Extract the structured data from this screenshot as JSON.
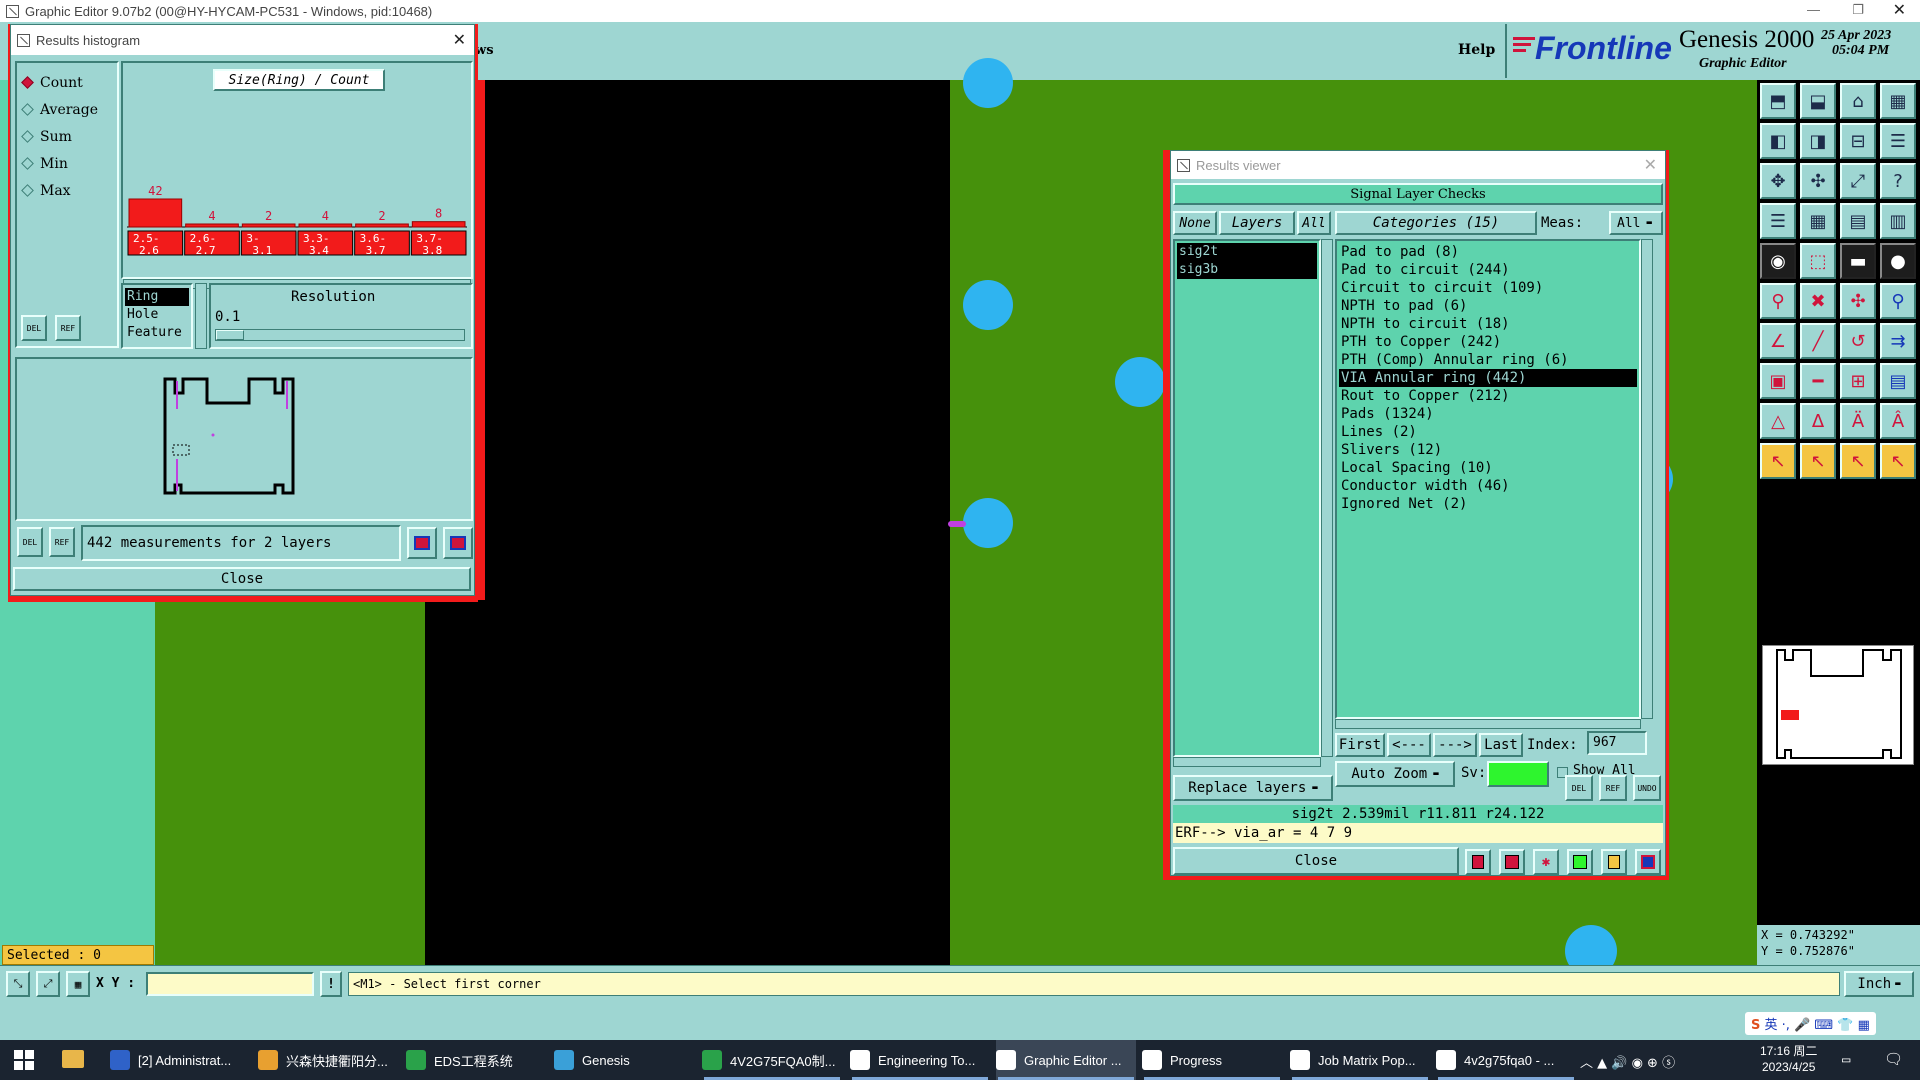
{
  "app": {
    "title": "Graphic Editor 9.07b2 (00@HY-HYCAM-PC531 - Windows, pid:10468)",
    "menu_partial": "ws",
    "help": "Help",
    "brand": "Frontline",
    "product": "Genesis 2000",
    "product_sub": "Graphic Editor",
    "date": "25 Apr 2023",
    "time": "05:04 PM"
  },
  "histogram": {
    "window_title": "Results histogram",
    "modes": [
      "Count",
      "Average",
      "Sum",
      "Min",
      "Max"
    ],
    "selected_mode": "Count",
    "header": "Size(Ring) / Count",
    "scope_items": [
      "Ring",
      "Hole",
      "Feature"
    ],
    "selected_scope": "Ring",
    "resolution_label": "Resolution",
    "resolution_value": "0.1",
    "status": "442 measurements for 2 layers",
    "close": "Close",
    "del": "DEL",
    "ref": "REF",
    "chart_data": {
      "type": "bar",
      "categories": [
        "2.5-2.6",
        "2.6-2.7",
        "3-3.1",
        "3.3-3.4",
        "3.6-3.7",
        "3.7-3.8"
      ],
      "values": [
        42,
        4,
        2,
        4,
        2,
        8
      ],
      "title": "Size(Ring) / Count",
      "xlabel": "",
      "ylabel": ""
    }
  },
  "viewer": {
    "window_title": "Results viewer",
    "header": "Signal Layer Checks",
    "none": "None",
    "layers": "Layers",
    "all": "All",
    "categories_label": "Categories (15)",
    "meas_label": "Meas:",
    "meas_value": "All",
    "layer_list": [
      "sig2t",
      "sig3b"
    ],
    "categories": [
      "Pad to pad (8)",
      "Pad to circuit (244)",
      "Circuit to circuit (109)",
      "NPTH to pad (6)",
      "NPTH to circuit (18)",
      "PTH to Copper (242)",
      "PTH (Comp) Annular ring (6)",
      "VIA Annular ring (442)",
      "Rout to Copper (212)",
      "Pads (1324)",
      "Lines (2)",
      "Slivers (12)",
      "Local Spacing (10)",
      "Conductor width (46)",
      "Ignored Net (2)"
    ],
    "selected_category": "VIA Annular ring (442)",
    "first": "First",
    "prev": "<---",
    "next": "--->",
    "last": "Last",
    "index_label": "Index:",
    "index_value": "967",
    "auto_zoom": "Auto Zoom",
    "sv": "Sv:",
    "show_all": "Show All",
    "replace_layers": "Replace layers",
    "del": "DEL",
    "ref": "REF",
    "undo": "UNDO",
    "info": "sig2t 2.539mil  r11.811  r24.122",
    "erf": "ERF--> via_ar = 4 7 9",
    "close": "Close"
  },
  "status": {
    "selected": "Selected : 0",
    "xy_label": "X Y :",
    "prompt": "<M1> - Select first corner",
    "units": "Inch",
    "coord_x": "X = 0.743292\"",
    "coord_y": "Y = 0.752876\""
  },
  "taskbar": {
    "items": [
      "[2] Administrat...",
      "兴森快捷衢阳分...",
      "EDS工程系统",
      "Genesis",
      "4V2G75FQA0制...",
      "Engineering To...",
      "Graphic Editor ...",
      "Progress",
      "Job Matrix Pop...",
      "4v2g75fqa0 - ..."
    ],
    "time": "17:16 周二",
    "date": "2023/4/25",
    "ime": "英"
  },
  "colors": {
    "teal": "#9ed6d2",
    "mint": "#5ed3ad",
    "board_green": "#46910c",
    "pad_blue": "#2fb4f0",
    "red": "#f21b1b"
  }
}
